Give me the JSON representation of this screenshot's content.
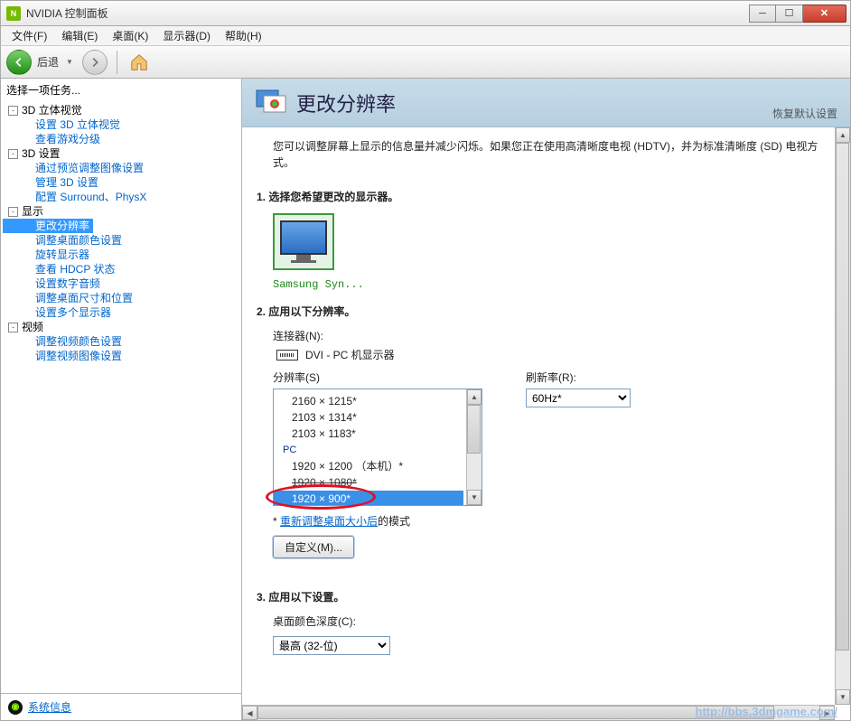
{
  "window": {
    "title": "NVIDIA 控制面板"
  },
  "menu": {
    "file": "文件(F)",
    "edit": "编辑(E)",
    "desktop": "桌面(K)",
    "display": "显示器(D)",
    "help": "帮助(H)"
  },
  "toolbar": {
    "back_label": "后退"
  },
  "sidebar": {
    "task_label": "选择一项任务...",
    "groups": [
      {
        "label": "3D 立体视觉",
        "items": [
          "设置 3D 立体视觉",
          "查看游戏分级"
        ]
      },
      {
        "label": "3D 设置",
        "items": [
          "通过预览调整图像设置",
          "管理 3D 设置",
          "配置 Surround、PhysX"
        ]
      },
      {
        "label": "显示",
        "items": [
          "更改分辨率",
          "调整桌面颜色设置",
          "旋转显示器",
          "查看 HDCP 状态",
          "设置数字音频",
          "调整桌面尺寸和位置",
          "设置多个显示器"
        ]
      },
      {
        "label": "视频",
        "items": [
          "调整视频颜色设置",
          "调整视频图像设置"
        ]
      }
    ],
    "active": "更改分辨率",
    "sysinfo": "系统信息"
  },
  "content": {
    "heading": "更改分辨率",
    "restore": "恢复默认设置",
    "desc": "您可以调整屏幕上显示的信息量并减少闪烁。如果您正在使用高清晰度电视 (HDTV)，并为标准清晰度 (SD) 电视方式。",
    "step1": "1.  选择您希望更改的显示器。",
    "monitor_name": "Samsung Syn...",
    "step2": "2.  应用以下分辨率。",
    "connector_label": "连接器(N):",
    "connector_value": "DVI - PC 机显示器",
    "resolution_label": "分辨率(S)",
    "refresh_label": "刷新率(R):",
    "refresh_value": "60Hz*",
    "res_items": [
      {
        "text": "2160 × 1215*",
        "type": "item"
      },
      {
        "text": "2103 × 1314*",
        "type": "item"
      },
      {
        "text": "2103 × 1183*",
        "type": "item"
      },
      {
        "text": "PC",
        "type": "group"
      },
      {
        "text": "1920 × 1200 （本机）*",
        "type": "item"
      },
      {
        "text": "1920 × 1080*",
        "type": "item",
        "striked": true
      },
      {
        "text": "1920 × 900*",
        "type": "item",
        "selected": true
      }
    ],
    "note_prefix": "* ",
    "note_link": "重新调整桌面大小后",
    "note_suffix": "的模式",
    "custom_btn": "自定义(M)...",
    "step3": "3.  应用以下设置。",
    "colordepth_label": "桌面颜色深度(C):",
    "colordepth_value": "最高 (32-位)"
  },
  "watermark": "http://bbs.3dmgame.com/"
}
